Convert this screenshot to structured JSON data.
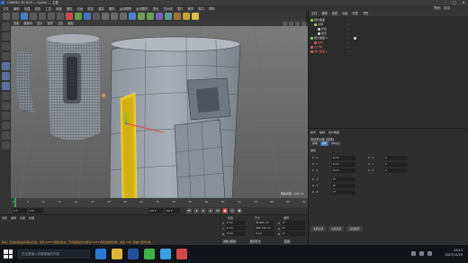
{
  "window": {
    "title": "CINEMA 4D R19 — Scene — 主要"
  },
  "menubar": {
    "items": [
      "文件",
      "编辑",
      "创建",
      "选择",
      "工具",
      "网格",
      "捕捉",
      "动画",
      "模拟",
      "渲染",
      "雕刻",
      "运动跟踪",
      "运动图形",
      "角色",
      "流水线",
      "插件",
      "脚本",
      "窗口",
      "帮助"
    ],
    "layout_label": "界面： 启动"
  },
  "viewport": {
    "menu": [
      "查看",
      "摄像机",
      "显示",
      "选项",
      "过滤",
      "面板"
    ],
    "stats": "网格间距 : 100 cm"
  },
  "timeline": {
    "ticks": [
      "0",
      "5",
      "10",
      "15",
      "20",
      "25",
      "30",
      "35",
      "40",
      "45",
      "50",
      "55",
      "60",
      "65",
      "70",
      "75",
      "80",
      "85",
      "90"
    ],
    "start_field": "0 F",
    "current_field": "0 F",
    "end_field": "90 F",
    "end_field2": "90 F"
  },
  "materials": {
    "tabs": [
      "创建",
      "编辑",
      "功能",
      "纹理"
    ],
    "status": "移动：点击并拖动鼠标移动元素。按住 SHIFT 键量化移动；节点编辑模式时按住 SHIFT 键增加选择对象；按住 CTRL 键减少选择对象。"
  },
  "coordinates": {
    "headers": [
      "位置",
      "尺寸",
      "旋转"
    ],
    "rows": [
      {
        "axis": "X",
        "pos": "0 cm",
        "size": "94.961 cm",
        "rot_label": "H",
        "rot": "0°"
      },
      {
        "axis": "Y",
        "pos": "0 cm",
        "size": "229.744 cm",
        "rot_label": "P",
        "rot": "0°"
      },
      {
        "axis": "Z",
        "pos": "0 cm",
        "size": "0 cm",
        "rot_label": "B",
        "rot": "0°"
      }
    ],
    "mode_select": "对象 (相对)",
    "size_select": "绝对尺寸",
    "apply_label": "应用"
  },
  "object_manager": {
    "tabs": [
      "文件",
      "编辑",
      "查看",
      "对象",
      "标签",
      "书签"
    ],
    "rows": [
      {
        "name": "细分曲面",
        "color": "#8fcf5a"
      },
      {
        "name": "对称",
        "color": "#8fcf5a"
      },
      {
        "name": "杯身",
        "color": "#d0d0d0"
      },
      {
        "name": "把手",
        "color": "#d0d0d0"
      },
      {
        "name": "细分曲面.1",
        "color": "#8fcf5a"
      },
      {
        "name": "柱体",
        "color": "#d05a5a"
      },
      {
        "name": "立方体",
        "color": "#d05a5a"
      },
      {
        "name": "细分曲面.2",
        "color": "#d05a5a"
      }
    ]
  },
  "attributes": {
    "tabs": [
      "模式",
      "编辑",
      "用户数据"
    ],
    "object_title": "多边形对象 [柱体]",
    "mode_tabs": [
      "基本",
      "坐标",
      "Phong"
    ],
    "section": "坐标",
    "props": [
      {
        "l1": "P . X",
        "v1": "0 cm",
        "l2": "S . X",
        "v2": "1"
      },
      {
        "l1": "P . Y",
        "v1": "0 cm",
        "l2": "S . Y",
        "v2": "1"
      },
      {
        "l1": "P . Z",
        "v1": "0 cm",
        "l2": "S . Z",
        "v2": "1"
      },
      {
        "l1": "R . H",
        "v1": "0°",
        "l2": "",
        "v2": ""
      },
      {
        "l1": "R . P",
        "v1": "0°",
        "l2": "",
        "v2": ""
      },
      {
        "l1": "R . B",
        "v1": "0°",
        "l2": "",
        "v2": ""
      }
    ],
    "buttons": [
      "冻结全部",
      "冻结位置",
      "冻结旋转"
    ]
  },
  "taskbar": {
    "search_placeholder": "在这里输入你要搜索的内容",
    "time": "23:12",
    "date": "2017/11/29"
  },
  "icons": [
    "start-icon",
    "search-icon",
    "browser-icon",
    "folder-icon",
    "c4d-icon",
    "wechat-icon",
    "qq-icon",
    "music-icon"
  ],
  "colors": {
    "accent_blue": "#3d6fb3",
    "highlight_yellow": "#e7c51c",
    "playhead_green": "#2fa84f"
  }
}
